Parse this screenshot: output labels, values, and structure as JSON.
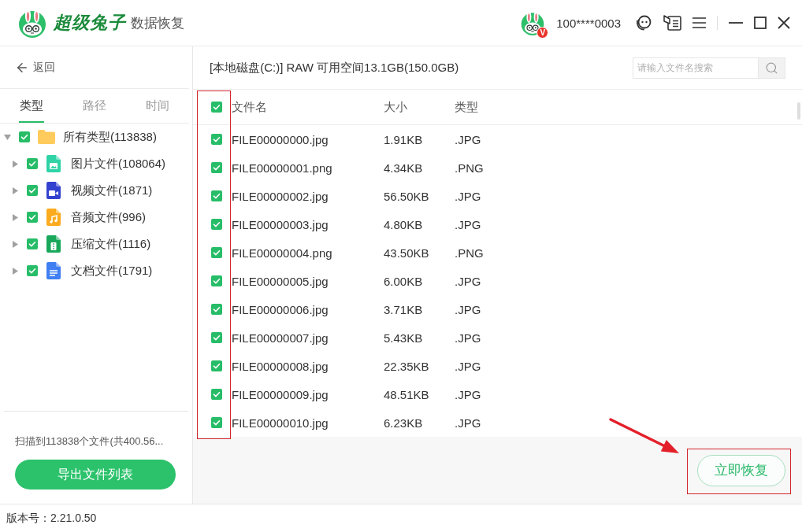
{
  "header": {
    "brand": "超级兔子",
    "product": "数据恢复",
    "user": {
      "vip_badge": "V",
      "account": "100****0003"
    }
  },
  "sidebar": {
    "back": "返回",
    "tabs": [
      {
        "label": "类型",
        "selected": true
      },
      {
        "label": "路径",
        "selected": false
      },
      {
        "label": "时间",
        "selected": false
      }
    ],
    "tree": [
      {
        "kind": "folder",
        "label": "所有类型(113838)",
        "checked": true,
        "expanded": true,
        "children": [
          {
            "kind": "image",
            "label": "图片文件(108064)",
            "checked": true,
            "expanded": false
          },
          {
            "kind": "video",
            "label": "视频文件(1871)",
            "checked": true,
            "expanded": false
          },
          {
            "kind": "audio",
            "label": "音频文件(996)",
            "checked": true,
            "expanded": false
          },
          {
            "kind": "archive",
            "label": "压缩文件(1116)",
            "checked": true,
            "expanded": false
          },
          {
            "kind": "document",
            "label": "文档文件(1791)",
            "checked": true,
            "expanded": false
          }
        ]
      }
    ],
    "summary": "扫描到113838个文件(共400.56...",
    "export_button": "导出文件列表"
  },
  "main": {
    "location": "[本地磁盘(C:)] RAW 可用空间13.1GB(150.0GB)",
    "search": {
      "placeholder": "请输入文件名搜索"
    },
    "table": {
      "all_checked": true,
      "columns": [
        "文件名",
        "大小",
        "类型"
      ],
      "rows": [
        {
          "checked": true,
          "name": "FILE00000000.jpg",
          "size": "1.91KB",
          "type": ".JPG"
        },
        {
          "checked": true,
          "name": "FILE00000001.png",
          "size": "4.34KB",
          "type": ".PNG"
        },
        {
          "checked": true,
          "name": "FILE00000002.jpg",
          "size": "56.50KB",
          "type": ".JPG"
        },
        {
          "checked": true,
          "name": "FILE00000003.jpg",
          "size": "4.80KB",
          "type": ".JPG"
        },
        {
          "checked": true,
          "name": "FILE00000004.png",
          "size": "43.50KB",
          "type": ".PNG"
        },
        {
          "checked": true,
          "name": "FILE00000005.jpg",
          "size": "6.00KB",
          "type": ".JPG"
        },
        {
          "checked": true,
          "name": "FILE00000006.jpg",
          "size": "3.71KB",
          "type": ".JPG"
        },
        {
          "checked": true,
          "name": "FILE00000007.jpg",
          "size": "5.43KB",
          "type": ".JPG"
        },
        {
          "checked": true,
          "name": "FILE00000008.jpg",
          "size": "22.35KB",
          "type": ".JPG"
        },
        {
          "checked": true,
          "name": "FILE00000009.jpg",
          "size": "48.51KB",
          "type": ".JPG"
        },
        {
          "checked": true,
          "name": "FILE00000010.jpg",
          "size": "6.23KB",
          "type": ".JPG"
        }
      ]
    },
    "recover_button": "立即恢复"
  },
  "status_bar": {
    "version": "版本号：2.21.0.50"
  }
}
